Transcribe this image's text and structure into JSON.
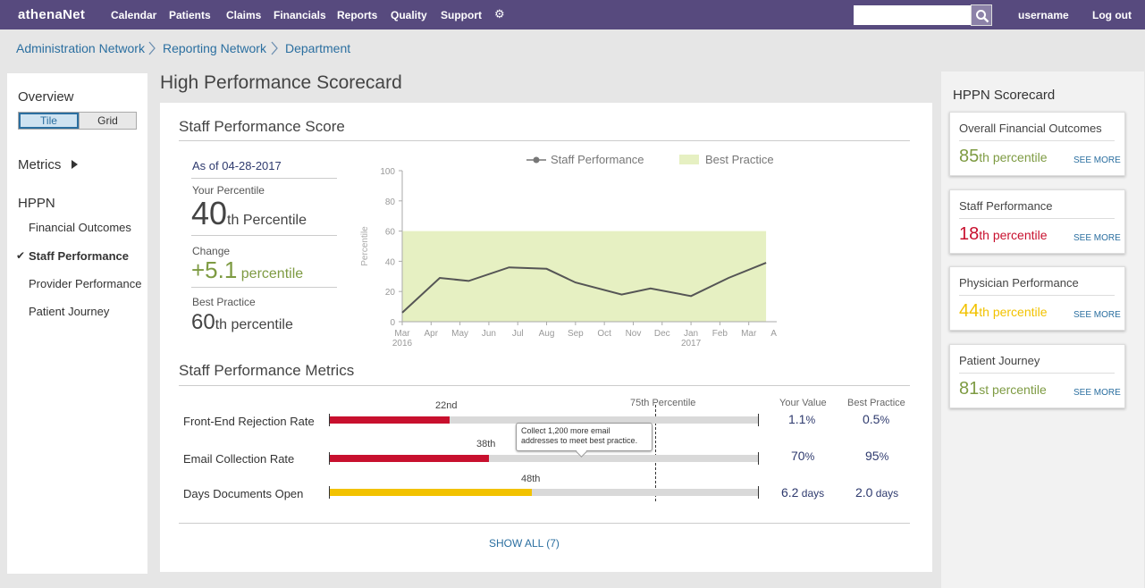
{
  "topbar": {
    "logo": "athenaNet",
    "nav": [
      "Calendar",
      "Patients",
      "Claims",
      "Financials",
      "Reports",
      "Quality",
      "Support"
    ],
    "gear_icon": "gear-icon",
    "search_placeholder": "",
    "search_icon": "search-icon",
    "username": "username",
    "logout": "Log out"
  },
  "breadcrumb": [
    "Administration Network",
    "Reporting Network",
    "Department"
  ],
  "sidebar": {
    "overview": "Overview",
    "toggle": {
      "tile": "Tile",
      "grid": "Grid"
    },
    "metrics": "Metrics",
    "hppn": "HPPN",
    "items": [
      {
        "label": "Financial Outcomes",
        "active": false
      },
      {
        "label": "Staff Performance",
        "active": true
      },
      {
        "label": "Provider Performance",
        "active": false
      },
      {
        "label": "Patient Journey",
        "active": false
      }
    ],
    "check": "✔"
  },
  "main": {
    "page_title": "High Performance Scorecard",
    "score_title": "Staff Performance Score",
    "as_of": "As of 04-28-2017",
    "your_percentile_label": "Your Percentile",
    "your_percentile_value": "40",
    "your_percentile_unit": "th Percentile",
    "change_label": "Change",
    "change_value": "+5.1",
    "change_unit": "percentile",
    "best_label": "Best Practice",
    "best_value": "60",
    "best_unit": "th percentile",
    "metrics_title": "Staff Performance Metrics",
    "col_75": "75th Percentile",
    "col_your": "Your Value",
    "col_best": "Best Practice",
    "metrics": [
      {
        "label": "Front-End Rejection Rate",
        "pct_label": "22nd",
        "fill": 0.28,
        "color": "#c8102e",
        "your": "1.1",
        "your_unit": "%",
        "best": "0.5",
        "best_unit": "%"
      },
      {
        "label": "Email Collection Rate",
        "pct_label": "38th",
        "fill": 0.37,
        "color": "#c8102e",
        "your": "70",
        "your_unit": "%",
        "best": "95",
        "best_unit": "%"
      },
      {
        "label": "Days Documents Open",
        "pct_label": "48th",
        "fill": 0.47,
        "color": "#f2c200",
        "your": "6.2",
        "your_unit": " days",
        "best": "2.0",
        "best_unit": " days"
      }
    ],
    "tooltip": "Collect 1,200 more email addresses to meet best practice.",
    "show_all": "SHOW ALL (7)"
  },
  "chart_data": {
    "type": "line",
    "title": "",
    "ylabel": "Percentile",
    "ylim": [
      0,
      100
    ],
    "yticks": [
      0,
      20,
      40,
      60,
      80,
      100
    ],
    "x": [
      "Mar",
      "Apr",
      "May",
      "Jun",
      "Jul",
      "Aug",
      "Sep",
      "Oct",
      "Nov",
      "Dec",
      "Jan",
      "Feb",
      "Mar",
      "Apr"
    ],
    "x_year_labels": {
      "0": "2016",
      "10": "2017"
    },
    "series": [
      {
        "name": "Staff Performance",
        "values": [
          6,
          29,
          27,
          36,
          35,
          26,
          18,
          22,
          17,
          29,
          39
        ],
        "x_index": [
          0,
          1.3,
          2.3,
          3.7,
          5,
          6,
          7.6,
          8.6,
          10,
          11.3,
          12.6
        ]
      }
    ],
    "band": {
      "name": "Best Practice",
      "from": 0,
      "to": 60,
      "color": "#e6f0c2"
    },
    "legend": "top"
  },
  "right_panel": {
    "title": "HPPN Scorecard",
    "see_more": "SEE MORE",
    "cards": [
      {
        "title": "Overall Financial Outcomes",
        "value": "85",
        "unit": "th percentile",
        "color": "green"
      },
      {
        "title": "Staff Performance",
        "value": "18",
        "unit": "th percentile",
        "color": "red"
      },
      {
        "title": "Physician Performance",
        "value": "44",
        "unit": "th percentile",
        "color": "yellow"
      },
      {
        "title": "Patient Journey",
        "value": "81",
        "unit": "st percentile",
        "color": "green"
      }
    ]
  }
}
